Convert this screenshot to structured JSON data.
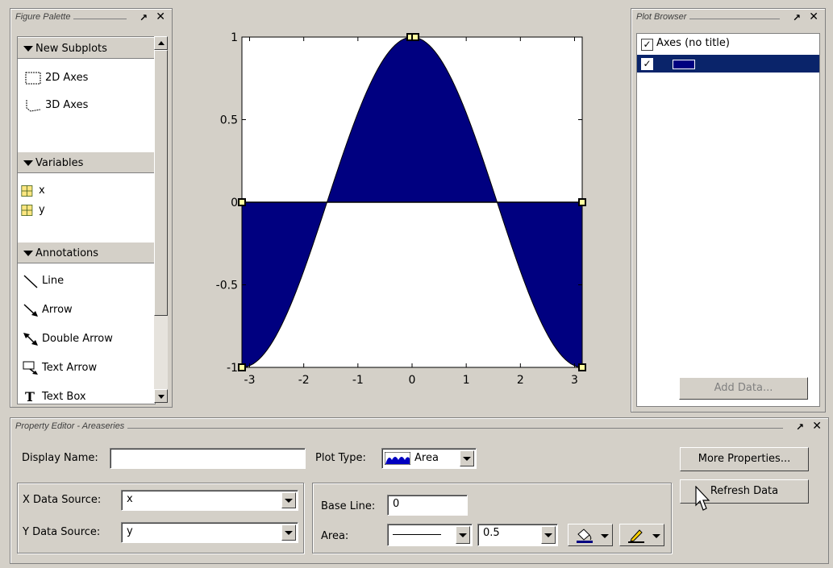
{
  "figure_palette": {
    "title": "Figure Palette",
    "sections": {
      "new_subplots": "New Subplots",
      "variables": "Variables",
      "annotations": "Annotations"
    },
    "subplots": [
      "2D Axes",
      "3D Axes"
    ],
    "variables": [
      "x",
      "y"
    ],
    "annotations": [
      "Line",
      "Arrow",
      "Double Arrow",
      "Text Arrow",
      "Text Box"
    ]
  },
  "plot": {
    "y_ticks": [
      "1",
      "0.5",
      "0",
      "-0.5",
      "-1"
    ],
    "x_ticks": [
      "-3",
      "-2",
      "-1",
      "0",
      "1",
      "2",
      "3"
    ],
    "fill_color": "#000080"
  },
  "chart_data": {
    "type": "area",
    "function": "cos(x)",
    "x": [
      -3.1416,
      -2.5,
      -2.0,
      -1.5708,
      -1.0,
      -0.5,
      0,
      0.5,
      1.0,
      1.5708,
      2.0,
      2.5,
      3.1416
    ],
    "y": [
      -1.0,
      -0.801,
      -0.416,
      0.0,
      0.54,
      0.878,
      1.0,
      0.878,
      0.54,
      0.0,
      -0.416,
      -0.801,
      -1.0
    ],
    "xlim": [
      -3.1416,
      3.1416
    ],
    "ylim": [
      -1,
      1
    ],
    "base_line": 0,
    "color": "#000080"
  },
  "plot_browser": {
    "title": "Plot Browser",
    "items": [
      {
        "label": "Axes (no title)",
        "checked": true
      },
      {
        "label": "",
        "checked": true
      }
    ],
    "add_data": "Add Data..."
  },
  "property_editor": {
    "title": "Property Editor - Areaseries",
    "display_name_label": "Display Name:",
    "display_name_value": "",
    "plot_type_label": "Plot Type:",
    "plot_type_value": "Area",
    "x_source_label": "X Data Source:",
    "x_source_value": "x",
    "y_source_label": "Y Data Source:",
    "y_source_value": "y",
    "base_line_label": "Base Line:",
    "base_line_value": "0",
    "area_label": "Area:",
    "line_width": "0.5",
    "more_properties": "More Properties...",
    "refresh_data": "Refresh Data"
  }
}
